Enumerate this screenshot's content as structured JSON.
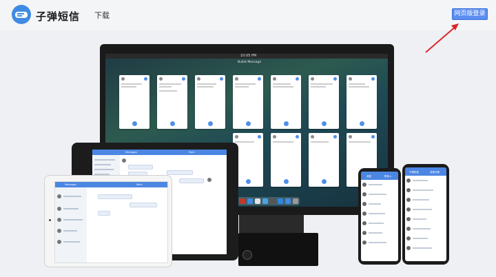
{
  "header": {
    "brand": "子弹短信",
    "nav_download": "下载",
    "web_login_button": "网页版登录",
    "logo_color": "#4a90e2",
    "button_color": "#5b8ef0",
    "arrow_color": "#d9262a"
  },
  "monitor": {
    "clock": "10:05 PM",
    "app_title": "Bullet Message"
  },
  "tablet_big": {
    "header_left": "Messages",
    "header_right": "Mark"
  },
  "tablet_small": {
    "header_left": "Messages",
    "header_right": "Mark"
  },
  "phone_left": {
    "header_left": "消息",
    "header_right": "联系人"
  },
  "phone_right": {
    "header_left": "子弹短信",
    "header_right": "消息列表"
  },
  "icons": [
    "bullet-message-logo-icon",
    "red-arrow-icon"
  ]
}
